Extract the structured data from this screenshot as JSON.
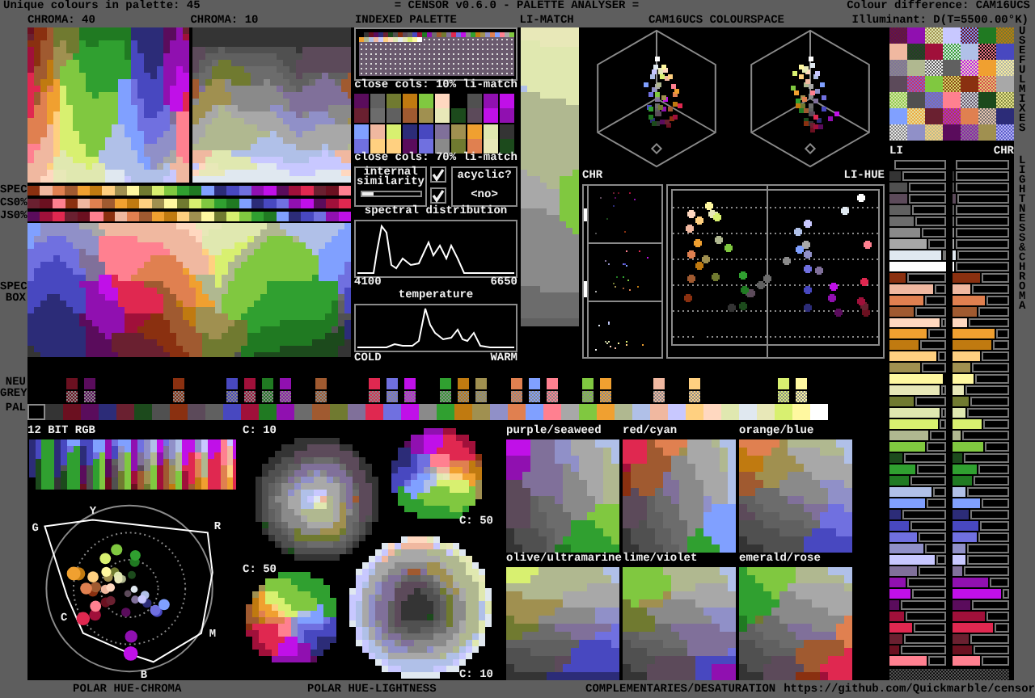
{
  "header": {
    "palette_count": "Unique colours in palette: 45",
    "title": "= CENSOR v0.6.0 - PALETTE ANALYSER =",
    "colour_difference": "Colour difference: CAM16UCS",
    "illuminant": "Illuminant: D(T=5500.00°K)"
  },
  "chroma_panels": [
    {
      "label": "CHROMA: 40"
    },
    {
      "label": "CHROMA: 10"
    }
  ],
  "indexed_palette": {
    "label": "INDEXED PALETTE"
  },
  "li_match": {
    "label": "LI-MATCH"
  },
  "colourspace": {
    "label": "CAM16UCS COLOURSPACE",
    "chroma_label": "CHR",
    "hue_label": "LI-HUE"
  },
  "spectrum_rows": [
    {
      "label": "SPEC"
    },
    {
      "label": "CS0%"
    },
    {
      "label": "JS0%"
    }
  ],
  "spec_box": {
    "label": "SPEC BOX"
  },
  "close_cols": [
    {
      "label": "close cols: 10% li-match"
    },
    {
      "label": "close cols: 70% li-match"
    }
  ],
  "internal_similarity": {
    "label": "internal similarity",
    "checked": true,
    "level": 0.2
  },
  "acyclic": {
    "label": "acyclic?",
    "checked": true,
    "value": "<no>"
  },
  "spectral_distribution": {
    "title": "spectral distribution",
    "min_label": "4100",
    "max_label": "6650"
  },
  "temperature": {
    "title": "temperature",
    "min_label": "COLD",
    "max_label": "WARM"
  },
  "neutral_grey": {
    "label": "NEU GREY"
  },
  "palette": {
    "label": "PAL",
    "colors": [
      {
        "color": "#000000"
      },
      {
        "color": "#343434"
      },
      {
        "color": "#6b1020"
      },
      {
        "color": "#5a0c5c"
      },
      {
        "color": "#2c2c78"
      },
      {
        "color": "#6a2030"
      },
      {
        "color": "#1c4a1c"
      },
      {
        "color": "#505050"
      },
      {
        "color": "#8a3010"
      },
      {
        "color": "#5c4a5a"
      },
      {
        "color": "#606060"
      },
      {
        "color": "#4848c0"
      },
      {
        "color": "#a0103a"
      },
      {
        "color": "#207a22"
      },
      {
        "color": "#9010b0"
      },
      {
        "color": "#6c6c6c"
      },
      {
        "color": "#a05a30"
      },
      {
        "color": "#707a30"
      },
      {
        "color": "#80709a"
      },
      {
        "color": "#e02850"
      },
      {
        "color": "#7070e0"
      },
      {
        "color": "#c010e8"
      },
      {
        "color": "#8a8a8a"
      },
      {
        "color": "#30a030"
      },
      {
        "color": "#c07a10"
      },
      {
        "color": "#a09050"
      },
      {
        "color": "#9090c8"
      },
      {
        "color": "#e08050"
      },
      {
        "color": "#80a0ff"
      },
      {
        "color": "#ff8090"
      },
      {
        "color": "#a8a8a8"
      },
      {
        "color": "#80c840"
      },
      {
        "color": "#f0a030"
      },
      {
        "color": "#b0b890"
      },
      {
        "color": "#b0c0e8"
      },
      {
        "color": "#f0b8a0"
      },
      {
        "color": "#c8c8ff"
      },
      {
        "color": "#ffd080"
      },
      {
        "color": "#ffd8c0"
      },
      {
        "color": "#e0e8b0"
      },
      {
        "color": "#e0e8f0"
      },
      {
        "color": "#e8e8b8"
      },
      {
        "color": "#d8f070"
      },
      {
        "color": "#fff8a0"
      },
      {
        "color": "#ffffff"
      }
    ]
  },
  "rgb12": {
    "label": "12 BIT RGB"
  },
  "polar_hue_chroma": {
    "caption": "POLAR HUE-CHROMA",
    "hue_labels": [
      "G",
      "Y",
      "R",
      "C",
      "B",
      "M"
    ]
  },
  "polar_hue_lightness": {
    "caption": "POLAR HUE-LIGHTNESS",
    "wheels": [
      {
        "label": "C: 10"
      },
      {
        "label": "C: 50"
      },
      {
        "label": "C: 50"
      },
      {
        "label": "C: 10"
      }
    ]
  },
  "complementaries": {
    "caption": "COMPLEMENTARIES/DESATURATION",
    "pairs": [
      {
        "label": "purple/seaweed"
      },
      {
        "label": "red/cyan"
      },
      {
        "label": "orange/blue"
      },
      {
        "label": "olive/ultramarine"
      },
      {
        "label": "lime/violet"
      },
      {
        "label": "emerald/rose"
      }
    ]
  },
  "useful_mixes": {
    "label": "USEFUL MIXES"
  },
  "lightness_chroma": {
    "label": "LIGHTNESS & CHROMA",
    "li_label": "LI",
    "chr_label": "CHR"
  },
  "footer": {
    "url": "https://github.com/Quickmarble/censor"
  }
}
